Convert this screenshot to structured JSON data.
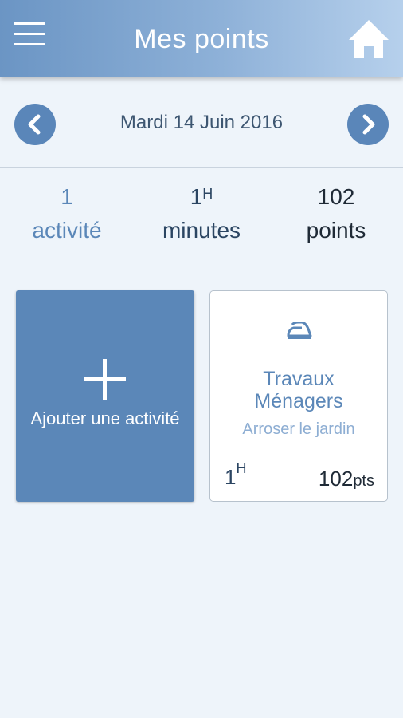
{
  "header": {
    "title": "Mes points",
    "menu_icon": "hamburger-icon",
    "home_icon": "home-icon"
  },
  "date_nav": {
    "date": "Mardi 14 Juin 2016",
    "prev_icon": "chevron-left-icon",
    "next_icon": "chevron-right-icon"
  },
  "stats": {
    "activities": {
      "value": "1",
      "label": "activité"
    },
    "minutes": {
      "value": "1",
      "unit": "H",
      "label": "minutes"
    },
    "points": {
      "value": "102",
      "label": "points"
    }
  },
  "add_card": {
    "label": "Ajouter une activité",
    "icon": "plus-icon"
  },
  "activity_card": {
    "icon": "iron-icon",
    "category_line1": "Travaux",
    "category_line2": "Ménagers",
    "description": "Arroser le jardin",
    "duration_value": "1",
    "duration_unit": "H",
    "points_value": "102",
    "points_unit": "pts"
  },
  "colors": {
    "accent": "#5b87b8",
    "background": "#eef4fa"
  }
}
